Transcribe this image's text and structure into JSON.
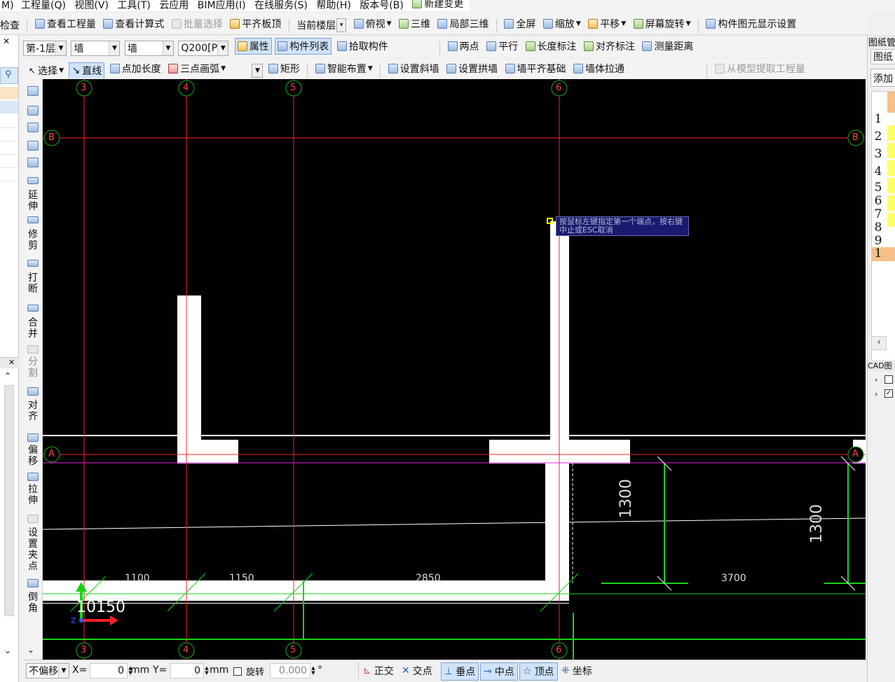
{
  "menubar": [
    "M)",
    "工程量(Q)",
    "视图(V)",
    "工具(T)",
    "云应用",
    "BIM应用(I)",
    "在线服务(S)",
    "帮助(H)",
    "版本号(B)",
    "新建变更"
  ],
  "toolbar1": {
    "check_label": "检查",
    "view_quantity": "查看工程量",
    "view_formula": "查看计算式",
    "batch_select": "批量选择",
    "align_slab_top": "平齐板顶",
    "current_floor": "当前楼层",
    "top_view": "俯视",
    "three_d": "三维",
    "partial_3d": "局部三维",
    "full_screen": "全屏",
    "zoom": "缩放",
    "pan": "平移",
    "screen_rotate": "屏幕旋转",
    "component_display": "构件图元显示设置"
  },
  "toolbar2": {
    "floor_value": "第-1层",
    "type1_value": "墙",
    "type2_value": "墙",
    "component_value": "Q200[P",
    "properties": "属性",
    "component_list": "构件列表",
    "pick_component": "拾取构件",
    "two_points": "两点",
    "parallel": "平行",
    "length_dim": "长度标注",
    "aligned_dim": "对齐标注",
    "measure_distance": "测量距离"
  },
  "toolbar3": {
    "select": "选择",
    "line": "直线",
    "point_add_length": "点加长度",
    "three_point_arc": "三点画弧",
    "rectangle": "矩形",
    "smart_layout": "智能布置",
    "set_slope_wall": "设置斜墙",
    "set_arch_wall": "设置拱墙",
    "wall_align_foundation": "墙平齐基础",
    "wall_stretch": "墙体拉通",
    "extract_quantity": "从模型提取工程量"
  },
  "left_tools": [
    "延伸",
    "修剪",
    "打断",
    "合并",
    "分割",
    "对齐",
    "偏移",
    "拉伸",
    "设置夹点",
    "倒角"
  ],
  "canvas": {
    "axis_labels_top": [
      "3",
      "4",
      "5",
      "6"
    ],
    "axis_labels_bottom": [
      "3",
      "4",
      "5",
      "6"
    ],
    "axis_labels_row": [
      "B",
      "A"
    ],
    "hint_text": "按鼠标左键指定第一个端点，按右键中止或ESC取消",
    "dims_bottom": [
      "1100",
      "1150",
      "2850",
      "3700"
    ],
    "dims_vertical": [
      "1300",
      "1300"
    ],
    "coord_readout": "10150"
  },
  "right_panel": {
    "title": "图纸管",
    "tab": "图纸",
    "add_button": "添加",
    "row_numbers": [
      "1",
      "2",
      "3",
      "4",
      "5",
      "6",
      "7",
      "8",
      "9",
      "1"
    ],
    "cad_layer_title": "CAD图"
  },
  "statusbar": {
    "offset_mode": "不偏移",
    "x_label": "X=",
    "x_value": "0",
    "x_unit": "mm",
    "y_label": "Y=",
    "y_value": "0",
    "y_unit": "mm",
    "rotate_label": "旋转",
    "rotate_value": "0.000",
    "degree": "°",
    "ortho": "正交",
    "intersection": "交点",
    "perpendicular": "垂点",
    "midpoint": "中点",
    "vertex": "顶点",
    "coordinate": "坐标"
  },
  "colors": {
    "canvas_bg": "#000000",
    "axis_line": "#ff2020",
    "axis_circle": "#1faa1f",
    "dim_line": "#19d219",
    "wall": "#ffffff",
    "hint_bg": "#1a1a6e"
  }
}
